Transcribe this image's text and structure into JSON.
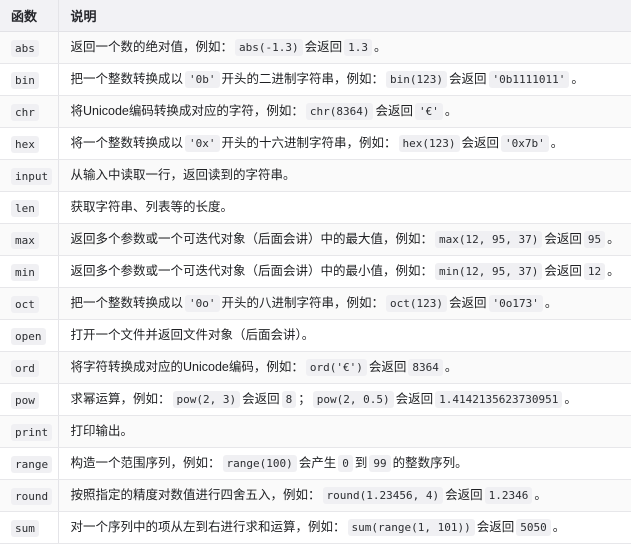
{
  "table": {
    "columns": [
      {
        "key": "name",
        "label": "函数"
      },
      {
        "key": "desc",
        "label": "说明"
      }
    ],
    "rows": [
      {
        "name": "abs",
        "parts": [
          {
            "t": "text",
            "v": "返回一个数的绝对值，例如："
          },
          {
            "t": "code",
            "v": "abs(-1.3)"
          },
          {
            "t": "text",
            "v": "会返回"
          },
          {
            "t": "code",
            "v": "1.3"
          },
          {
            "t": "text",
            "v": "。"
          }
        ]
      },
      {
        "name": "bin",
        "parts": [
          {
            "t": "text",
            "v": "把一个整数转换成以"
          },
          {
            "t": "code",
            "v": "'0b'"
          },
          {
            "t": "text",
            "v": "开头的二进制字符串，例如："
          },
          {
            "t": "code",
            "v": "bin(123)"
          },
          {
            "t": "text",
            "v": "会返回"
          },
          {
            "t": "code",
            "v": "'0b1111011'"
          },
          {
            "t": "text",
            "v": "。"
          }
        ]
      },
      {
        "name": "chr",
        "parts": [
          {
            "t": "text",
            "v": "将Unicode编码转换成对应的字符，例如："
          },
          {
            "t": "code",
            "v": "chr(8364)"
          },
          {
            "t": "text",
            "v": "会返回"
          },
          {
            "t": "code",
            "v": "'€'"
          },
          {
            "t": "text",
            "v": "。"
          }
        ]
      },
      {
        "name": "hex",
        "parts": [
          {
            "t": "text",
            "v": "将一个整数转换成以"
          },
          {
            "t": "code",
            "v": "'0x'"
          },
          {
            "t": "text",
            "v": "开头的十六进制字符串，例如："
          },
          {
            "t": "code",
            "v": "hex(123)"
          },
          {
            "t": "text",
            "v": "会返回"
          },
          {
            "t": "code",
            "v": "'0x7b'"
          },
          {
            "t": "text",
            "v": "。"
          }
        ]
      },
      {
        "name": "input",
        "parts": [
          {
            "t": "text",
            "v": "从输入中读取一行，返回读到的字符串。"
          }
        ]
      },
      {
        "name": "len",
        "parts": [
          {
            "t": "text",
            "v": "获取字符串、列表等的长度。"
          }
        ]
      },
      {
        "name": "max",
        "parts": [
          {
            "t": "text",
            "v": "返回多个参数或一个可迭代对象（后面会讲）中的最大值，例如："
          },
          {
            "t": "code",
            "v": "max(12, 95, 37)"
          },
          {
            "t": "text",
            "v": "会返回"
          },
          {
            "t": "code",
            "v": "95"
          },
          {
            "t": "text",
            "v": "。"
          }
        ]
      },
      {
        "name": "min",
        "parts": [
          {
            "t": "text",
            "v": "返回多个参数或一个可迭代对象（后面会讲）中的最小值，例如："
          },
          {
            "t": "code",
            "v": "min(12, 95, 37)"
          },
          {
            "t": "text",
            "v": "会返回"
          },
          {
            "t": "code",
            "v": "12"
          },
          {
            "t": "text",
            "v": "。"
          }
        ]
      },
      {
        "name": "oct",
        "parts": [
          {
            "t": "text",
            "v": "把一个整数转换成以"
          },
          {
            "t": "code",
            "v": "'0o'"
          },
          {
            "t": "text",
            "v": "开头的八进制字符串，例如："
          },
          {
            "t": "code",
            "v": "oct(123)"
          },
          {
            "t": "text",
            "v": "会返回"
          },
          {
            "t": "code",
            "v": "'0o173'"
          },
          {
            "t": "text",
            "v": "。"
          }
        ]
      },
      {
        "name": "open",
        "parts": [
          {
            "t": "text",
            "v": "打开一个文件并返回文件对象（后面会讲）。"
          }
        ]
      },
      {
        "name": "ord",
        "parts": [
          {
            "t": "text",
            "v": "将字符转换成对应的Unicode编码，例如："
          },
          {
            "t": "code",
            "v": "ord('€')"
          },
          {
            "t": "text",
            "v": "会返回"
          },
          {
            "t": "code",
            "v": "8364"
          },
          {
            "t": "text",
            "v": "。"
          }
        ]
      },
      {
        "name": "pow",
        "parts": [
          {
            "t": "text",
            "v": "求幂运算，例如："
          },
          {
            "t": "code",
            "v": "pow(2, 3)"
          },
          {
            "t": "text",
            "v": "会返回"
          },
          {
            "t": "code",
            "v": "8"
          },
          {
            "t": "text",
            "v": "；"
          },
          {
            "t": "code",
            "v": "pow(2, 0.5)"
          },
          {
            "t": "text",
            "v": "会返回"
          },
          {
            "t": "code",
            "v": "1.4142135623730951"
          },
          {
            "t": "text",
            "v": "。"
          }
        ]
      },
      {
        "name": "print",
        "parts": [
          {
            "t": "text",
            "v": "打印输出。"
          }
        ]
      },
      {
        "name": "range",
        "parts": [
          {
            "t": "text",
            "v": "构造一个范围序列，例如："
          },
          {
            "t": "code",
            "v": "range(100)"
          },
          {
            "t": "text",
            "v": "会产生"
          },
          {
            "t": "code",
            "v": "0"
          },
          {
            "t": "text",
            "v": "到"
          },
          {
            "t": "code",
            "v": "99"
          },
          {
            "t": "text",
            "v": "的整数序列。"
          }
        ]
      },
      {
        "name": "round",
        "parts": [
          {
            "t": "text",
            "v": "按照指定的精度对数值进行四舍五入，例如："
          },
          {
            "t": "code",
            "v": "round(1.23456, 4)"
          },
          {
            "t": "text",
            "v": "会返回"
          },
          {
            "t": "code",
            "v": "1.2346"
          },
          {
            "t": "text",
            "v": "。"
          }
        ]
      },
      {
        "name": "sum",
        "parts": [
          {
            "t": "text",
            "v": "对一个序列中的项从左到右进行求和运算，例如："
          },
          {
            "t": "code",
            "v": "sum(range(1, 101))"
          },
          {
            "t": "text",
            "v": "会返回"
          },
          {
            "t": "code",
            "v": "5050"
          },
          {
            "t": "text",
            "v": "。"
          }
        ]
      }
    ]
  },
  "colors": {
    "header_bg": "#f2f2f5",
    "row_odd_bg": "#fafafa",
    "row_even_bg": "#ffffff",
    "border": "#e7e7ea",
    "chip_bg": "#f0f0f3",
    "text": "#1f2023"
  }
}
